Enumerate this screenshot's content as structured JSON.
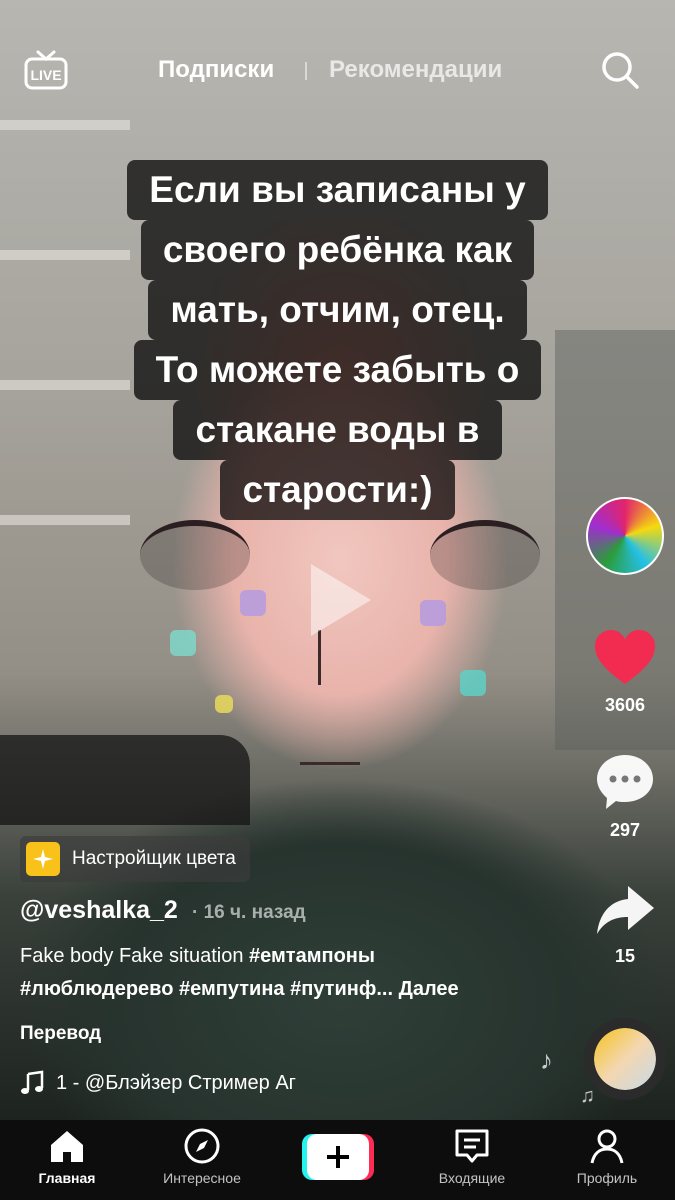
{
  "top_nav": {
    "live_label": "LIVE",
    "tab_following": "Подписки",
    "tab_for_you": "Рекомендации"
  },
  "overlay_caption": {
    "lines": [
      "Если вы записаны у",
      "своего ребёнка как",
      "мать, отчим, отец.",
      "То можете забыть о",
      "стакане воды в",
      "старости:)"
    ]
  },
  "right_rail": {
    "like_count": "3606",
    "comment_count": "297",
    "share_count": "15"
  },
  "effect": {
    "label": "Настройщик цвета"
  },
  "post": {
    "username": "@veshalka_2",
    "time_ago": "· 16 ч. назад",
    "description_text": "Fake body Fake situation ",
    "hashtag_1": "#емтампоны",
    "hashtag_2": "#люблюдерево",
    "hashtag_3": "#емпутина",
    "hashtag_4": "#путинф...",
    "more_label": "Далее",
    "translate_label": "Перевод",
    "music_text": "1 - @Блэйзер   Стример Аг"
  },
  "bottom_nav": {
    "home": "Главная",
    "discover": "Интересное",
    "inbox": "Входящие",
    "profile": "Профиль"
  },
  "colors": {
    "like_red": "#f22c50",
    "plus_cyan": "#25f4ee",
    "plus_pink": "#fe2c55",
    "effect_yellow": "#f8c21b"
  }
}
